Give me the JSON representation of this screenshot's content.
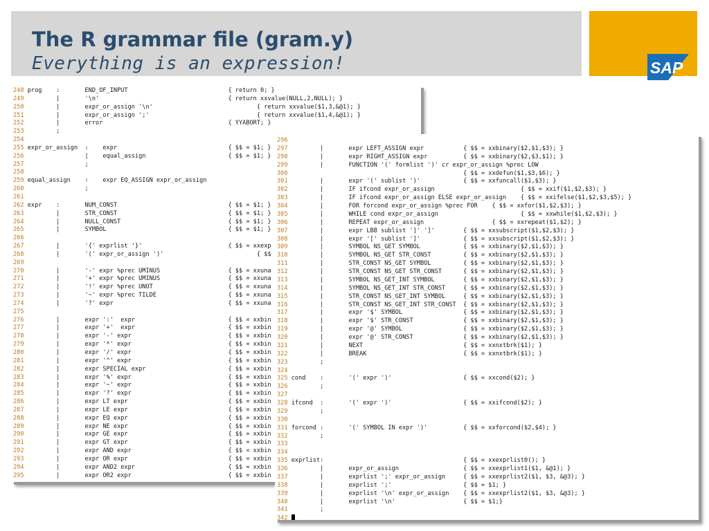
{
  "slide": {
    "title": "The R grammar file (gram.y)",
    "subtitle": "Everything is an expression!",
    "logo_text": "SAP",
    "colors": {
      "title": "#2a4d6e",
      "title_bar": "#d6d6d6",
      "logo_bg": "#f0ab00",
      "line_numbers": "#c07a1a"
    }
  },
  "panel1": {
    "lines": [
      {
        "n": "248",
        "t": "prog    :       END_OF_INPUT                            { return 0; }"
      },
      {
        "n": "249",
        "t": "        |       '\\n'                                    { return xxvalue(NULL,2,NULL); }"
      },
      {
        "n": "250",
        "t": "        |       expr_or_assign '\\n'                             { return xxvalue($1,3,&@1); }"
      },
      {
        "n": "251",
        "t": "        |       expr_or_assign ';'                              { return xxvalue($1,4,&@1); }"
      },
      {
        "n": "252",
        "t": "        |       error                                   { YYABORT; }"
      },
      {
        "n": "253",
        "t": "        ;"
      },
      {
        "n": "254",
        "t": ""
      },
      {
        "n": "255",
        "t": "expr_or_assign  :    expr                               { $$ = $1; }"
      },
      {
        "n": "256",
        "t": "                |    equal_assign                       { $$ = $1; }"
      },
      {
        "n": "257",
        "t": "                ;"
      },
      {
        "n": "258",
        "t": ""
      },
      {
        "n": "259",
        "t": "equal_assign    :    expr EQ_ASSIGN expr_or_assign"
      },
      {
        "n": "260",
        "t": "                ;"
      },
      {
        "n": "261",
        "t": ""
      },
      {
        "n": "262",
        "t": "expr    :       NUM_CONST                               { $$ = $1; }"
      },
      {
        "n": "263",
        "t": "        |       STR_CONST                               { $$ = $1; }"
      },
      {
        "n": "264",
        "t": "        |       NULL_CONST                              { $$ = $1; }"
      },
      {
        "n": "265",
        "t": "        |       SYMBOL                                  { $$ = $1; }"
      },
      {
        "n": "266",
        "t": ""
      },
      {
        "n": "267",
        "t": "        |       '{' exprlist '}'                        { $$ = xxexp"
      },
      {
        "n": "268",
        "t": "        |       '(' expr_or_assign ')'                          { $$"
      },
      {
        "n": "269",
        "t": ""
      },
      {
        "n": "270",
        "t": "        |       '-' expr %prec UMINUS                   { $$ = xxuna"
      },
      {
        "n": "271",
        "t": "        |       '+' expr %prec UMINUS                   { $$ = xxuna"
      },
      {
        "n": "272",
        "t": "        |       '!' expr %prec UNOT                     { $$ = xxuna"
      },
      {
        "n": "273",
        "t": "        |       '~' expr %prec TILDE                    { $$ = xxuna"
      },
      {
        "n": "274",
        "t": "        |       '?' expr                                { $$ = xxuna"
      },
      {
        "n": "275",
        "t": ""
      },
      {
        "n": "276",
        "t": "        |       expr ':'  expr                          { $$ = xxbin"
      },
      {
        "n": "277",
        "t": "        |       expr '+'  expr                          { $$ = xxbin"
      },
      {
        "n": "278",
        "t": "        |       expr '-' expr                           { $$ = xxbin"
      },
      {
        "n": "279",
        "t": "        |       expr '*' expr                           { $$ = xxbin"
      },
      {
        "n": "280",
        "t": "        |       expr '/' expr                           { $$ = xxbin"
      },
      {
        "n": "281",
        "t": "        |       expr '^' expr                           { $$ = xxbin"
      },
      {
        "n": "282",
        "t": "        |       expr SPECIAL expr                       { $$ = xxbin"
      },
      {
        "n": "283",
        "t": "        |       expr '%' expr                           { $$ = xxbin"
      },
      {
        "n": "284",
        "t": "        |       expr '~' expr                           { $$ = xxbin"
      },
      {
        "n": "285",
        "t": "        |       expr '?' expr                           { $$ = xxbin"
      },
      {
        "n": "286",
        "t": "        |       expr LT expr                            { $$ = xxbin"
      },
      {
        "n": "287",
        "t": "        |       expr LE expr                            { $$ = xxbin"
      },
      {
        "n": "288",
        "t": "        |       expr EQ expr                            { $$ = xxbin"
      },
      {
        "n": "289",
        "t": "        |       expr NE expr                            { $$ = xxbin"
      },
      {
        "n": "290",
        "t": "        |       expr GE expr                            { $$ = xxbin"
      },
      {
        "n": "291",
        "t": "        |       expr GT expr                            { $$ = xxbin"
      },
      {
        "n": "292",
        "t": "        |       expr AND expr                           { $$ = xxbin"
      },
      {
        "n": "293",
        "t": "        |       expr OR expr                            { $$ = xxbin"
      },
      {
        "n": "294",
        "t": "        |       expr AND2 expr                          { $$ = xxbin"
      },
      {
        "n": "295",
        "t": "        |       expr OR2 expr                           { $$ = xxbin",
        "cursor": true
      }
    ]
  },
  "panel2": {
    "lines": [
      {
        "n": "296",
        "t": ""
      },
      {
        "n": "297",
        "t": "        |       expr LEFT_ASSIGN expr           { $$ = xxbinary($2,$1,$3); }"
      },
      {
        "n": "298",
        "t": "        |       expr RIGHT_ASSIGN expr          { $$ = xxbinary($2,$3,$1); }"
      },
      {
        "n": "299",
        "t": "        |       FUNCTION '(' formlist ')' cr expr_or_assign %prec LOW"
      },
      {
        "n": "300",
        "t": "                                                { $$ = xxdefun($1,$3,$6); }"
      },
      {
        "n": "301",
        "t": "        |       expr '(' sublist ')'            { $$ = xxfuncall($1,$3); }"
      },
      {
        "n": "302",
        "t": "        |       IF ifcond expr_or_assign                        { $$ = xxif($1,$2,$3); }"
      },
      {
        "n": "303",
        "t": "        |       IF ifcond expr_or_assign ELSE expr_or_assign    { $$ = xxifelse($1,$2,$3,$5); }"
      },
      {
        "n": "304",
        "t": "        |       FOR forcond expr_or_assign %prec FOR    { $$ = xxfor($1,$2,$3); }"
      },
      {
        "n": "305",
        "t": "        |       WHILE cond expr_or_assign                       { $$ = xxwhile($1,$2,$3); }"
      },
      {
        "n": "306",
        "t": "        |       REPEAT expr_or_assign                   { $$ = xxrepeat($1,$2); }"
      },
      {
        "n": "307",
        "t": "        |       expr LBB sublist ']' ']'        { $$ = xxsubscript($1,$2,$3); }"
      },
      {
        "n": "308",
        "t": "        |       expr '[' sublist ']'            { $$ = xxsubscript($1,$2,$3); }"
      },
      {
        "n": "309",
        "t": "        |       SYMBOL NS_GET SYMBOL            { $$ = xxbinary($2,$1,$3); }"
      },
      {
        "n": "310",
        "t": "        |       SYMBOL NS_GET STR_CONST         { $$ = xxbinary($2,$1,$3); }"
      },
      {
        "n": "311",
        "t": "        |       STR_CONST NS_GET SYMBOL         { $$ = xxbinary($2,$1,$3); }"
      },
      {
        "n": "312",
        "t": "        |       STR_CONST NS_GET STR_CONST      { $$ = xxbinary($2,$1,$3); }"
      },
      {
        "n": "313",
        "t": "        |       SYMBOL NS_GET_INT SYMBOL        { $$ = xxbinary($2,$1,$3); }"
      },
      {
        "n": "314",
        "t": "        |       SYMBOL NS_GET_INT STR_CONST     { $$ = xxbinary($2,$1,$3); }"
      },
      {
        "n": "315",
        "t": "        |       STR_CONST NS_GET_INT SYMBOL     { $$ = xxbinary($2,$1,$3); }"
      },
      {
        "n": "316",
        "t": "        |       STR_CONST NS_GET_INT STR_CONST  { $$ = xxbinary($2,$1,$3); }"
      },
      {
        "n": "317",
        "t": "        |       expr '$' SYMBOL                 { $$ = xxbinary($2,$1,$3); }"
      },
      {
        "n": "318",
        "t": "        |       expr '$' STR_CONST              { $$ = xxbinary($2,$1,$3); }"
      },
      {
        "n": "319",
        "t": "        |       expr '@' SYMBOL                 { $$ = xxbinary($2,$1,$3); }"
      },
      {
        "n": "320",
        "t": "        |       expr '@' STR_CONST              { $$ = xxbinary($2,$1,$3); }"
      },
      {
        "n": "321",
        "t": "        |       NEXT                            { $$ = xxnxtbrk($1); }"
      },
      {
        "n": "322",
        "t": "        |       BREAK                           { $$ = xxnxtbrk($1); }"
      },
      {
        "n": "323",
        "t": "        ;"
      },
      {
        "n": "324",
        "t": ""
      },
      {
        "n": "325",
        "t": "cond    :       '(' expr ')'                    { $$ = xxcond($2); }"
      },
      {
        "n": "326",
        "t": "        ;"
      },
      {
        "n": "327",
        "t": ""
      },
      {
        "n": "328",
        "t": "ifcond  :       '(' expr ')'                    { $$ = xxifcond($2); }"
      },
      {
        "n": "329",
        "t": "        ;"
      },
      {
        "n": "330",
        "t": ""
      },
      {
        "n": "331",
        "t": "forcond :       '(' SYMBOL IN expr ')'          { $$ = xxforcond($2,$4); }"
      },
      {
        "n": "332",
        "t": "        ;"
      },
      {
        "n": "333",
        "t": ""
      },
      {
        "n": "334",
        "t": ""
      },
      {
        "n": "335",
        "t": "exprlist:                                       { $$ = xxexprlist0(); }"
      },
      {
        "n": "336",
        "t": "        |       expr_or_assign                  { $$ = xxexprlist1($1, &@1); }"
      },
      {
        "n": "337",
        "t": "        |       exprlist ';' expr_or_assign     { $$ = xxexprlist2($1, $3, &@3); }"
      },
      {
        "n": "338",
        "t": "        |       exprlist ';'                    { $$ = $1; }"
      },
      {
        "n": "339",
        "t": "        |       exprlist '\\n' expr_or_assign    { $$ = xxexprlist2($1, $3, &@3); }"
      },
      {
        "n": "340",
        "t": "        |       exprlist '\\n'                   { $$ = $1;}"
      },
      {
        "n": "341",
        "t": "        ;"
      },
      {
        "n": "342",
        "t": "",
        "cursor": true
      }
    ]
  }
}
